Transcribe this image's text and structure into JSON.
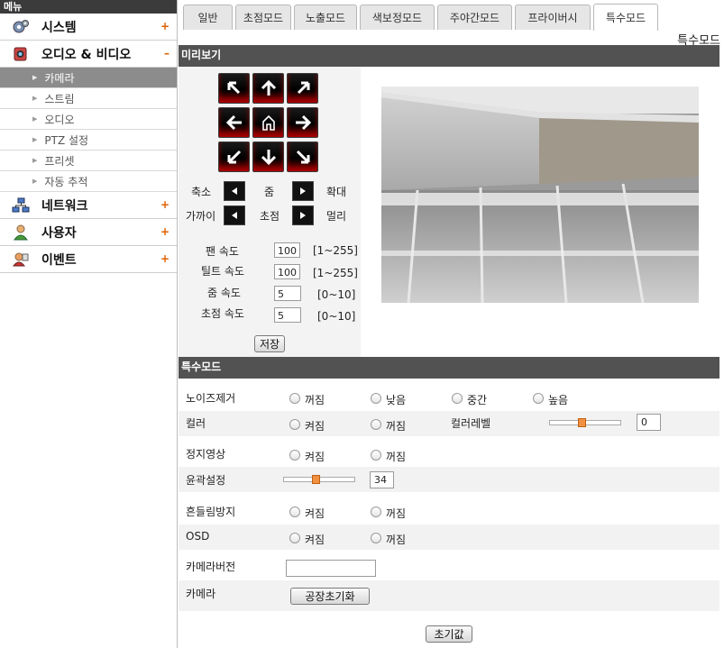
{
  "sidebar": {
    "header": "메뉴",
    "items": [
      {
        "label": "시스템",
        "toggle": "+"
      },
      {
        "label": "오디오 & 비디오",
        "toggle": "–"
      },
      {
        "label": "네트워크",
        "toggle": "+"
      },
      {
        "label": "사용자",
        "toggle": "+"
      },
      {
        "label": "이벤트",
        "toggle": "+"
      }
    ],
    "subitems": [
      "카메라",
      "스트림",
      "오디오",
      "PTZ 설정",
      "프리셋",
      "자동 추적"
    ]
  },
  "tabs": [
    "일반",
    "초점모드",
    "노출모드",
    "색보정모드",
    "주야간모드",
    "프라이버시",
    "특수모드"
  ],
  "tab_caption": "특수모드",
  "preview": {
    "title": "미리보기",
    "zoom": {
      "left": "축소",
      "mid": "줌",
      "right": "확대"
    },
    "focus": {
      "left": "가까이",
      "mid": "초점",
      "right": "멀리"
    },
    "speeds": [
      {
        "label": "팬 속도",
        "value": "100",
        "range": "[1~255]"
      },
      {
        "label": "틸트 속도",
        "value": "100",
        "range": "[1~255]"
      },
      {
        "label": "줌 속도",
        "value": "5",
        "range": "[0~10]"
      },
      {
        "label": "초점 속도",
        "value": "5",
        "range": "[0~10]"
      }
    ],
    "save": "저장"
  },
  "special": {
    "title": "특수모드",
    "noise": {
      "label": "노이즈제거",
      "options": [
        "꺼짐",
        "낮음",
        "중간",
        "높음"
      ]
    },
    "color": {
      "label": "컬러",
      "options": [
        "켜짐",
        "꺼짐"
      ],
      "level_label": "컬러레벨",
      "level_value": "0",
      "level_fraction": 0.45
    },
    "still": {
      "label": "정지영상",
      "options": [
        "켜짐",
        "꺼짐"
      ]
    },
    "edge": {
      "label": "윤곽설정",
      "value": "34",
      "fraction": 0.45
    },
    "stabilize": {
      "label": "흔들림방지",
      "options": [
        "켜짐",
        "꺼짐"
      ]
    },
    "osd": {
      "label": "OSD",
      "options": [
        "켜짐",
        "꺼짐"
      ]
    },
    "version": {
      "label": "카메라버전",
      "value": ""
    },
    "camera": {
      "label": "카메라",
      "button": "공장초기화"
    },
    "default_button": "초기값"
  }
}
